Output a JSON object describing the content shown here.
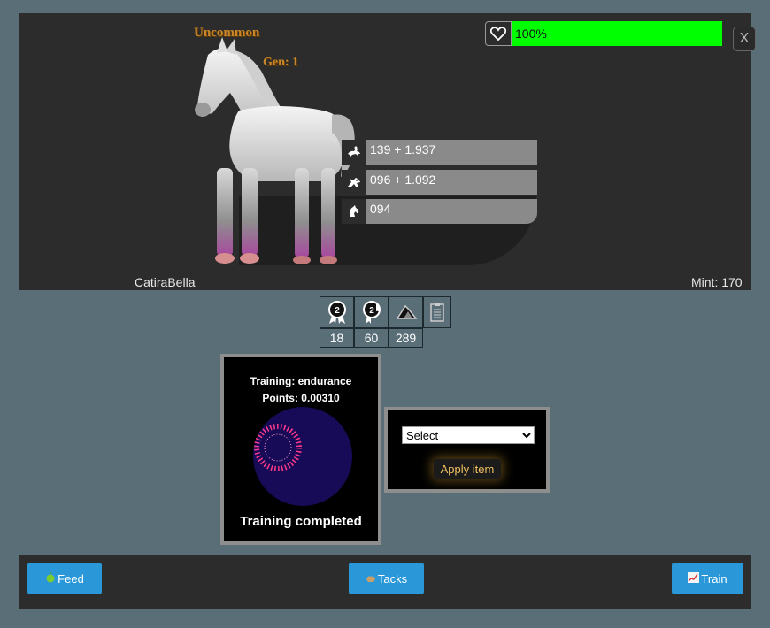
{
  "horse": {
    "rarity": "Uncommon",
    "gen": "Gen: 1",
    "name": "CatiraBella",
    "mint": "Mint: 170",
    "health": {
      "label": "100%",
      "fraction": 1.0,
      "color": "#00ff00"
    }
  },
  "close_label": "X",
  "stats": [
    {
      "icon": "jockey-horse-icon",
      "value": "139 + 1.937"
    },
    {
      "icon": "running-horse-icon",
      "value": "096 + 1.092"
    },
    {
      "icon": "horse-head-icon",
      "value": "094"
    }
  ],
  "badges": [
    {
      "icon": "award-ribbon-icon",
      "count": "18"
    },
    {
      "icon": "horse-ribbon-icon",
      "count": "60"
    },
    {
      "icon": "horseshoe-pile-icon",
      "count": "289"
    },
    {
      "icon": "clipboard-icon",
      "count": ""
    }
  ],
  "training": {
    "title": "Training: endurance",
    "points": "Points: 0.00310",
    "status": "Training completed"
  },
  "item": {
    "select_value": "Select",
    "apply_label": "Apply item"
  },
  "actions": {
    "feed_label": "Feed",
    "tacks_label": "Tacks",
    "train_label": "Train"
  },
  "colors": {
    "accent": "#2a98d8",
    "health": "#00ff00",
    "rarity": "#c9862a"
  }
}
